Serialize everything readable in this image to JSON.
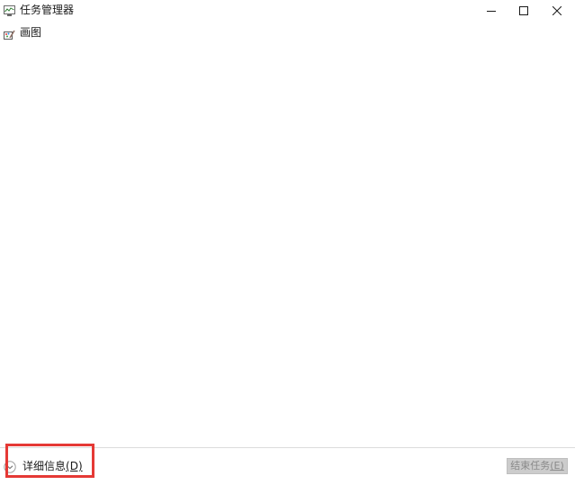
{
  "window": {
    "title": "任务管理器",
    "icon": "task-manager-icon",
    "controls": {
      "minimize_icon": "minimize-icon",
      "maximize_icon": "maximize-icon",
      "close_icon": "close-icon"
    }
  },
  "processes": [
    {
      "name": "画图",
      "icon": "paint-app-icon"
    }
  ],
  "footer": {
    "details_label": "详细信息",
    "details_accel": "(D)",
    "details_icon": "chevron-down-circle-icon",
    "end_task_label": "结束任务",
    "end_task_accel": "(E)",
    "end_task_enabled": false
  },
  "colors": {
    "highlight": "#e53935",
    "disabled_button_bg": "#cccccc",
    "disabled_button_text": "#8a8a8a"
  }
}
